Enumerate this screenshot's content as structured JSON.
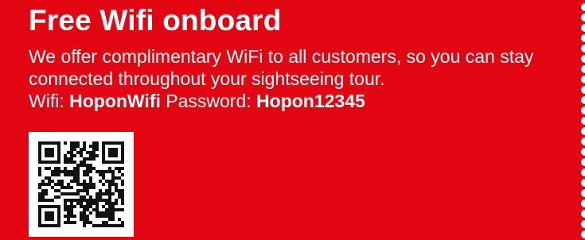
{
  "card": {
    "title": "Free Wifi onboard",
    "description": "We offer complimentary WiFi to all customers, so you can stay connected throughout your sightseeing tour.",
    "wifi_label": "Wifi:",
    "wifi_name": "HoponWifi",
    "password_label": "Password:",
    "password": "Hopon12345"
  },
  "qr": {
    "icon": "qr-code-icon"
  },
  "colors": {
    "background": "#e20612",
    "text": "#ffffff"
  }
}
